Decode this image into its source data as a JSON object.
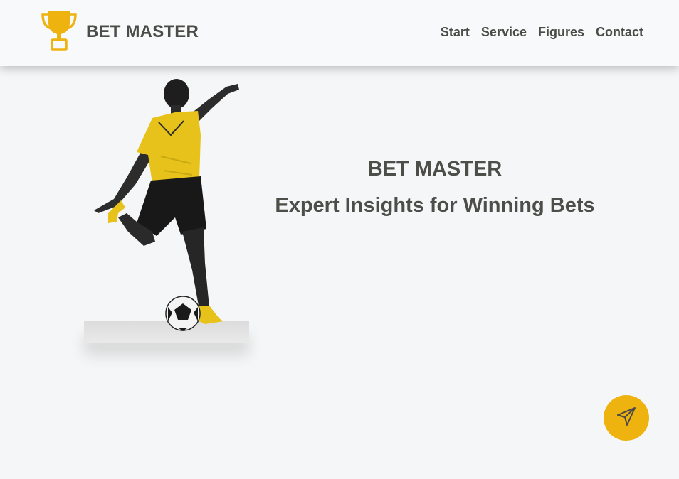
{
  "brand": {
    "name": "BET MASTER",
    "logo_icon": "trophy-icon",
    "accent": "#eeb30f"
  },
  "nav": {
    "items": [
      {
        "label": "Start"
      },
      {
        "label": "Service"
      },
      {
        "label": "Figures"
      },
      {
        "label": "Contact"
      }
    ]
  },
  "hero": {
    "title": "BET MASTER",
    "subtitle": "Expert Insights for Winning Bets",
    "image_icon": "soccer-player-image"
  },
  "fab": {
    "icon": "paper-plane-icon",
    "color": "#eeb30f"
  }
}
